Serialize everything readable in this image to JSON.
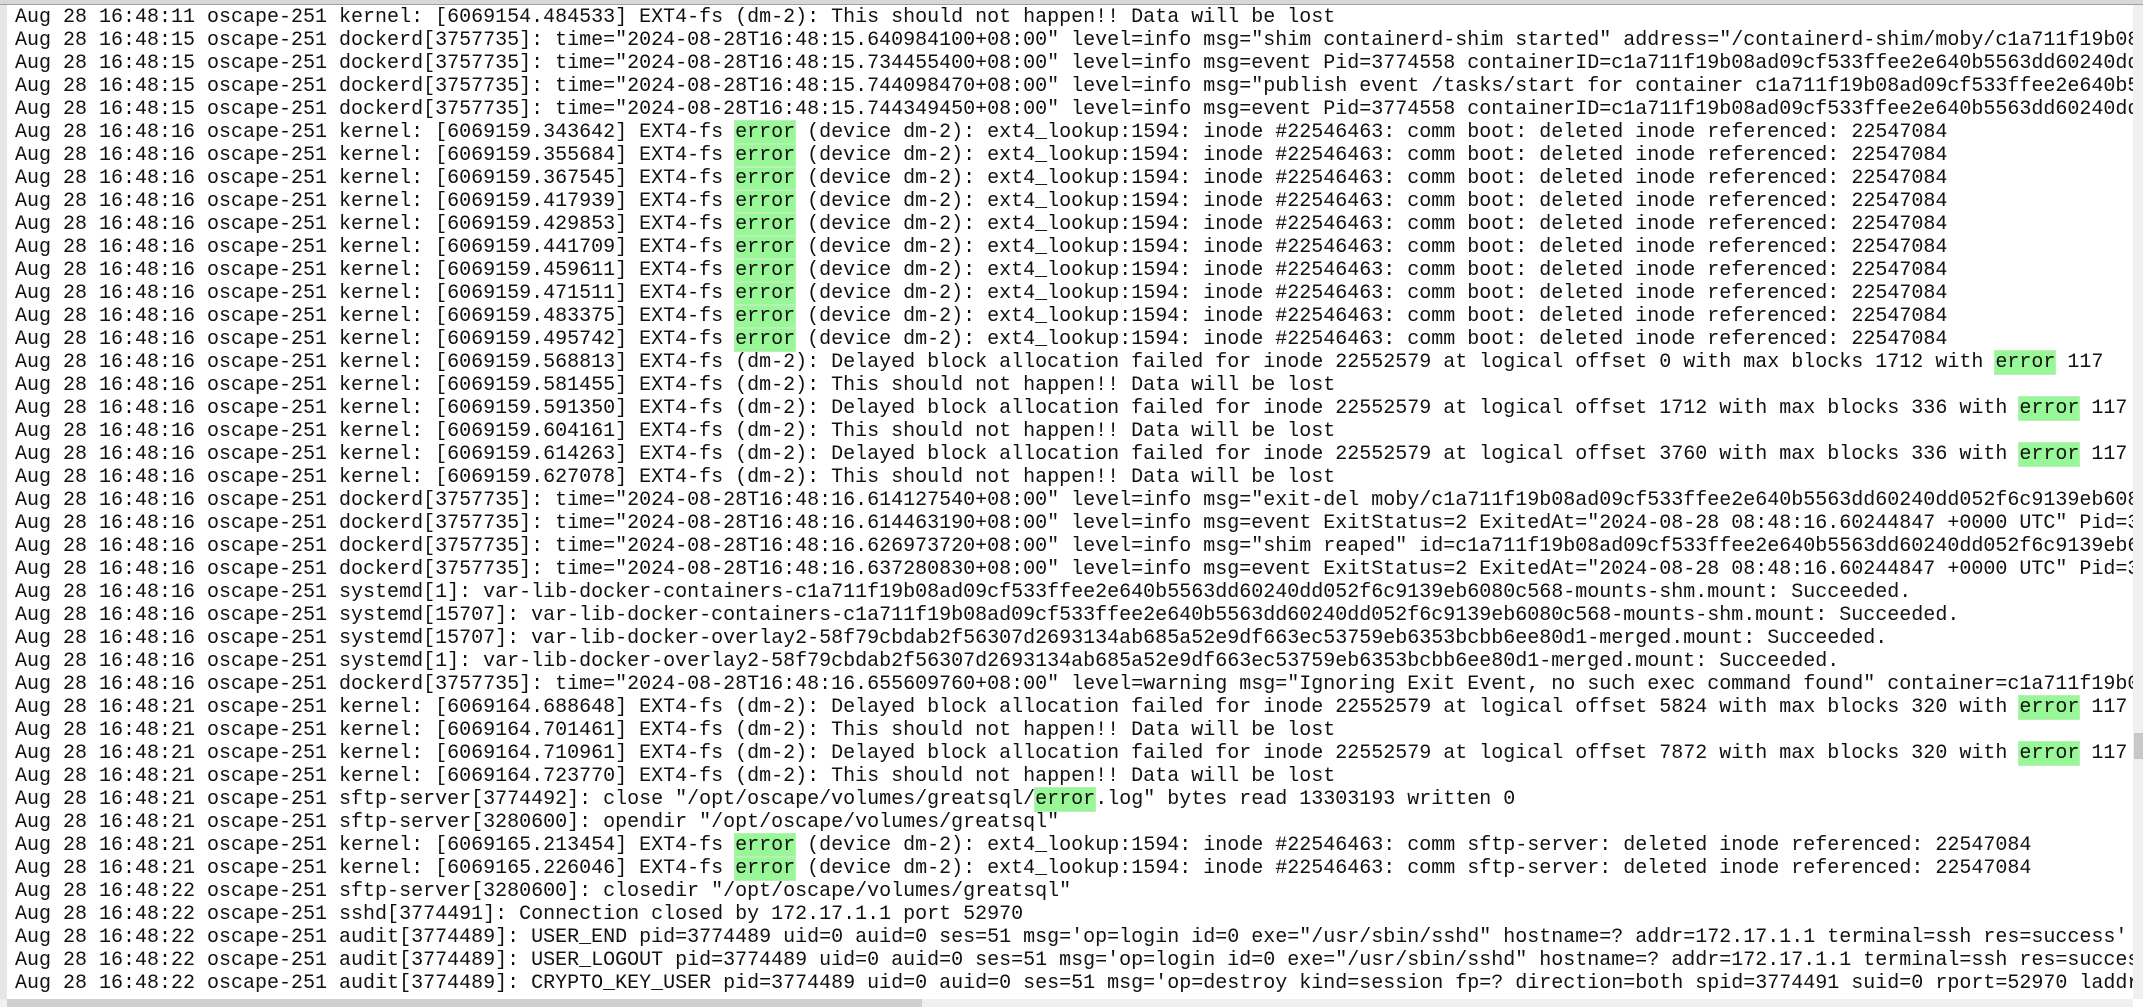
{
  "colors": {
    "highlight": "#98f898",
    "text": "#111111",
    "background": "#ffffff"
  },
  "search": {
    "highlighted_term": "error"
  },
  "lines": [
    "Aug 28 16:48:11 oscape-251 kernel: [6069154.484533] EXT4-fs (dm-2): This should not happen!! Data will be lost",
    "Aug 28 16:48:15 oscape-251 dockerd[3757735]: time=\"2024-08-28T16:48:15.640984100+08:00\" level=info msg=\"shim containerd-shim started\" address=\"/containerd-shim/moby/c1a711f19b08",
    "Aug 28 16:48:15 oscape-251 dockerd[3757735]: time=\"2024-08-28T16:48:15.734455400+08:00\" level=info msg=event Pid=3774558 containerID=c1a711f19b08ad09cf533ffee2e640b5563dd60240dd",
    "Aug 28 16:48:15 oscape-251 dockerd[3757735]: time=\"2024-08-28T16:48:15.744098470+08:00\" level=info msg=\"publish event /tasks/start for container c1a711f19b08ad09cf533ffee2e640b5",
    "Aug 28 16:48:15 oscape-251 dockerd[3757735]: time=\"2024-08-28T16:48:15.744349450+08:00\" level=info msg=event Pid=3774558 containerID=c1a711f19b08ad09cf533ffee2e640b5563dd60240dd",
    "Aug 28 16:48:16 oscape-251 kernel: [6069159.343642] EXT4-fs error (device dm-2): ext4_lookup:1594: inode #22546463: comm boot: deleted inode referenced: 22547084",
    "Aug 28 16:48:16 oscape-251 kernel: [6069159.355684] EXT4-fs error (device dm-2): ext4_lookup:1594: inode #22546463: comm boot: deleted inode referenced: 22547084",
    "Aug 28 16:48:16 oscape-251 kernel: [6069159.367545] EXT4-fs error (device dm-2): ext4_lookup:1594: inode #22546463: comm boot: deleted inode referenced: 22547084",
    "Aug 28 16:48:16 oscape-251 kernel: [6069159.417939] EXT4-fs error (device dm-2): ext4_lookup:1594: inode #22546463: comm boot: deleted inode referenced: 22547084",
    "Aug 28 16:48:16 oscape-251 kernel: [6069159.429853] EXT4-fs error (device dm-2): ext4_lookup:1594: inode #22546463: comm boot: deleted inode referenced: 22547084",
    "Aug 28 16:48:16 oscape-251 kernel: [6069159.441709] EXT4-fs error (device dm-2): ext4_lookup:1594: inode #22546463: comm boot: deleted inode referenced: 22547084",
    "Aug 28 16:48:16 oscape-251 kernel: [6069159.459611] EXT4-fs error (device dm-2): ext4_lookup:1594: inode #22546463: comm boot: deleted inode referenced: 22547084",
    "Aug 28 16:48:16 oscape-251 kernel: [6069159.471511] EXT4-fs error (device dm-2): ext4_lookup:1594: inode #22546463: comm boot: deleted inode referenced: 22547084",
    "Aug 28 16:48:16 oscape-251 kernel: [6069159.483375] EXT4-fs error (device dm-2): ext4_lookup:1594: inode #22546463: comm boot: deleted inode referenced: 22547084",
    "Aug 28 16:48:16 oscape-251 kernel: [6069159.495742] EXT4-fs error (device dm-2): ext4_lookup:1594: inode #22546463: comm boot: deleted inode referenced: 22547084",
    "Aug 28 16:48:16 oscape-251 kernel: [6069159.568813] EXT4-fs (dm-2): Delayed block allocation failed for inode 22552579 at logical offset 0 with max blocks 1712 with error 117",
    "Aug 28 16:48:16 oscape-251 kernel: [6069159.581455] EXT4-fs (dm-2): This should not happen!! Data will be lost",
    "Aug 28 16:48:16 oscape-251 kernel: [6069159.591350] EXT4-fs (dm-2): Delayed block allocation failed for inode 22552579 at logical offset 1712 with max blocks 336 with error 117",
    "Aug 28 16:48:16 oscape-251 kernel: [6069159.604161] EXT4-fs (dm-2): This should not happen!! Data will be lost",
    "Aug 28 16:48:16 oscape-251 kernel: [6069159.614263] EXT4-fs (dm-2): Delayed block allocation failed for inode 22552579 at logical offset 3760 with max blocks 336 with error 117",
    "Aug 28 16:48:16 oscape-251 kernel: [6069159.627078] EXT4-fs (dm-2): This should not happen!! Data will be lost",
    "Aug 28 16:48:16 oscape-251 dockerd[3757735]: time=\"2024-08-28T16:48:16.614127540+08:00\" level=info msg=\"exit-del moby/c1a711f19b08ad09cf533ffee2e640b5563dd60240dd052f6c9139eb608",
    "Aug 28 16:48:16 oscape-251 dockerd[3757735]: time=\"2024-08-28T16:48:16.614463190+08:00\" level=info msg=event ExitStatus=2 ExitedAt=\"2024-08-28 08:48:16.60244847 +0000 UTC\" Pid=3",
    "Aug 28 16:48:16 oscape-251 dockerd[3757735]: time=\"2024-08-28T16:48:16.626973720+08:00\" level=info msg=\"shim reaped\" id=c1a711f19b08ad09cf533ffee2e640b5563dd60240dd052f6c9139eb6",
    "Aug 28 16:48:16 oscape-251 dockerd[3757735]: time=\"2024-08-28T16:48:16.637280830+08:00\" level=info msg=event ExitStatus=2 ExitedAt=\"2024-08-28 08:48:16.60244847 +0000 UTC\" Pid=3",
    "Aug 28 16:48:16 oscape-251 systemd[1]: var-lib-docker-containers-c1a711f19b08ad09cf533ffee2e640b5563dd60240dd052f6c9139eb6080c568-mounts-shm.mount: Succeeded.",
    "Aug 28 16:48:16 oscape-251 systemd[15707]: var-lib-docker-containers-c1a711f19b08ad09cf533ffee2e640b5563dd60240dd052f6c9139eb6080c568-mounts-shm.mount: Succeeded.",
    "Aug 28 16:48:16 oscape-251 systemd[15707]: var-lib-docker-overlay2-58f79cbdab2f56307d2693134ab685a52e9df663ec53759eb6353bcbb6ee80d1-merged.mount: Succeeded.",
    "Aug 28 16:48:16 oscape-251 systemd[1]: var-lib-docker-overlay2-58f79cbdab2f56307d2693134ab685a52e9df663ec53759eb6353bcbb6ee80d1-merged.mount: Succeeded.",
    "Aug 28 16:48:16 oscape-251 dockerd[3757735]: time=\"2024-08-28T16:48:16.655609760+08:00\" level=warning msg=\"Ignoring Exit Event, no such exec command found\" container=c1a711f19b0",
    "Aug 28 16:48:21 oscape-251 kernel: [6069164.688648] EXT4-fs (dm-2): Delayed block allocation failed for inode 22552579 at logical offset 5824 with max blocks 320 with error 117",
    "Aug 28 16:48:21 oscape-251 kernel: [6069164.701461] EXT4-fs (dm-2): This should not happen!! Data will be lost",
    "Aug 28 16:48:21 oscape-251 kernel: [6069164.710961] EXT4-fs (dm-2): Delayed block allocation failed for inode 22552579 at logical offset 7872 with max blocks 320 with error 117",
    "Aug 28 16:48:21 oscape-251 kernel: [6069164.723770] EXT4-fs (dm-2): This should not happen!! Data will be lost",
    "Aug 28 16:48:21 oscape-251 sftp-server[3774492]: close \"/opt/oscape/volumes/greatsql/error.log\" bytes read 13303193 written 0",
    "Aug 28 16:48:21 oscape-251 sftp-server[3280600]: opendir \"/opt/oscape/volumes/greatsql\"",
    "Aug 28 16:48:21 oscape-251 kernel: [6069165.213454] EXT4-fs error (device dm-2): ext4_lookup:1594: inode #22546463: comm sftp-server: deleted inode referenced: 22547084",
    "Aug 28 16:48:21 oscape-251 kernel: [6069165.226046] EXT4-fs error (device dm-2): ext4_lookup:1594: inode #22546463: comm sftp-server: deleted inode referenced: 22547084",
    "Aug 28 16:48:22 oscape-251 sftp-server[3280600]: closedir \"/opt/oscape/volumes/greatsql\"",
    "Aug 28 16:48:22 oscape-251 sshd[3774491]: Connection closed by 172.17.1.1 port 52970",
    "Aug 28 16:48:22 oscape-251 audit[3774489]: USER_END pid=3774489 uid=0 auid=0 ses=51 msg='op=login id=0 exe=\"/usr/sbin/sshd\" hostname=? addr=172.17.1.1 terminal=ssh res=success'",
    "Aug 28 16:48:22 oscape-251 audit[3774489]: USER_LOGOUT pid=3774489 uid=0 auid=0 ses=51 msg='op=login id=0 exe=\"/usr/sbin/sshd\" hostname=? addr=172.17.1.1 terminal=ssh res=success'",
    "Aug 28 16:48:22 oscape-251 audit[3774489]: CRYPTO_KEY_USER pid=3774489 uid=0 auid=0 ses=51 msg='op=destroy kind=session fp=? direction=both spid=3774491 suid=0 rport=52970 laddr"
  ]
}
